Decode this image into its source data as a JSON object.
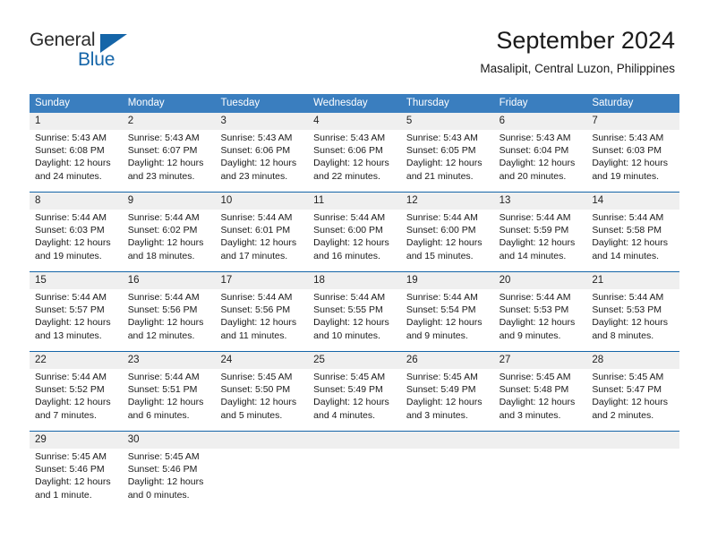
{
  "logo": {
    "word_one": "General",
    "word_two": "Blue",
    "triangle_icon": "triangle-icon"
  },
  "header": {
    "title": "September 2024",
    "subtitle": "Masalipit, Central Luzon, Philippines"
  },
  "colors": {
    "header_blue": "#3a7ebf",
    "separator_blue": "#1565a8",
    "number_band_gray": "#efefef",
    "logo_blue": "#1565a8"
  },
  "calendar": {
    "day_headers": [
      "Sunday",
      "Monday",
      "Tuesday",
      "Wednesday",
      "Thursday",
      "Friday",
      "Saturday"
    ],
    "weeks": [
      {
        "numbers": [
          "1",
          "2",
          "3",
          "4",
          "5",
          "6",
          "7"
        ],
        "cells": [
          {
            "sunrise": "Sunrise: 5:43 AM",
            "sunset": "Sunset: 6:08 PM",
            "daylight1": "Daylight: 12 hours",
            "daylight2": "and 24 minutes."
          },
          {
            "sunrise": "Sunrise: 5:43 AM",
            "sunset": "Sunset: 6:07 PM",
            "daylight1": "Daylight: 12 hours",
            "daylight2": "and 23 minutes."
          },
          {
            "sunrise": "Sunrise: 5:43 AM",
            "sunset": "Sunset: 6:06 PM",
            "daylight1": "Daylight: 12 hours",
            "daylight2": "and 23 minutes."
          },
          {
            "sunrise": "Sunrise: 5:43 AM",
            "sunset": "Sunset: 6:06 PM",
            "daylight1": "Daylight: 12 hours",
            "daylight2": "and 22 minutes."
          },
          {
            "sunrise": "Sunrise: 5:43 AM",
            "sunset": "Sunset: 6:05 PM",
            "daylight1": "Daylight: 12 hours",
            "daylight2": "and 21 minutes."
          },
          {
            "sunrise": "Sunrise: 5:43 AM",
            "sunset": "Sunset: 6:04 PM",
            "daylight1": "Daylight: 12 hours",
            "daylight2": "and 20 minutes."
          },
          {
            "sunrise": "Sunrise: 5:43 AM",
            "sunset": "Sunset: 6:03 PM",
            "daylight1": "Daylight: 12 hours",
            "daylight2": "and 19 minutes."
          }
        ]
      },
      {
        "numbers": [
          "8",
          "9",
          "10",
          "11",
          "12",
          "13",
          "14"
        ],
        "cells": [
          {
            "sunrise": "Sunrise: 5:44 AM",
            "sunset": "Sunset: 6:03 PM",
            "daylight1": "Daylight: 12 hours",
            "daylight2": "and 19 minutes."
          },
          {
            "sunrise": "Sunrise: 5:44 AM",
            "sunset": "Sunset: 6:02 PM",
            "daylight1": "Daylight: 12 hours",
            "daylight2": "and 18 minutes."
          },
          {
            "sunrise": "Sunrise: 5:44 AM",
            "sunset": "Sunset: 6:01 PM",
            "daylight1": "Daylight: 12 hours",
            "daylight2": "and 17 minutes."
          },
          {
            "sunrise": "Sunrise: 5:44 AM",
            "sunset": "Sunset: 6:00 PM",
            "daylight1": "Daylight: 12 hours",
            "daylight2": "and 16 minutes."
          },
          {
            "sunrise": "Sunrise: 5:44 AM",
            "sunset": "Sunset: 6:00 PM",
            "daylight1": "Daylight: 12 hours",
            "daylight2": "and 15 minutes."
          },
          {
            "sunrise": "Sunrise: 5:44 AM",
            "sunset": "Sunset: 5:59 PM",
            "daylight1": "Daylight: 12 hours",
            "daylight2": "and 14 minutes."
          },
          {
            "sunrise": "Sunrise: 5:44 AM",
            "sunset": "Sunset: 5:58 PM",
            "daylight1": "Daylight: 12 hours",
            "daylight2": "and 14 minutes."
          }
        ]
      },
      {
        "numbers": [
          "15",
          "16",
          "17",
          "18",
          "19",
          "20",
          "21"
        ],
        "cells": [
          {
            "sunrise": "Sunrise: 5:44 AM",
            "sunset": "Sunset: 5:57 PM",
            "daylight1": "Daylight: 12 hours",
            "daylight2": "and 13 minutes."
          },
          {
            "sunrise": "Sunrise: 5:44 AM",
            "sunset": "Sunset: 5:56 PM",
            "daylight1": "Daylight: 12 hours",
            "daylight2": "and 12 minutes."
          },
          {
            "sunrise": "Sunrise: 5:44 AM",
            "sunset": "Sunset: 5:56 PM",
            "daylight1": "Daylight: 12 hours",
            "daylight2": "and 11 minutes."
          },
          {
            "sunrise": "Sunrise: 5:44 AM",
            "sunset": "Sunset: 5:55 PM",
            "daylight1": "Daylight: 12 hours",
            "daylight2": "and 10 minutes."
          },
          {
            "sunrise": "Sunrise: 5:44 AM",
            "sunset": "Sunset: 5:54 PM",
            "daylight1": "Daylight: 12 hours",
            "daylight2": "and 9 minutes."
          },
          {
            "sunrise": "Sunrise: 5:44 AM",
            "sunset": "Sunset: 5:53 PM",
            "daylight1": "Daylight: 12 hours",
            "daylight2": "and 9 minutes."
          },
          {
            "sunrise": "Sunrise: 5:44 AM",
            "sunset": "Sunset: 5:53 PM",
            "daylight1": "Daylight: 12 hours",
            "daylight2": "and 8 minutes."
          }
        ]
      },
      {
        "numbers": [
          "22",
          "23",
          "24",
          "25",
          "26",
          "27",
          "28"
        ],
        "cells": [
          {
            "sunrise": "Sunrise: 5:44 AM",
            "sunset": "Sunset: 5:52 PM",
            "daylight1": "Daylight: 12 hours",
            "daylight2": "and 7 minutes."
          },
          {
            "sunrise": "Sunrise: 5:44 AM",
            "sunset": "Sunset: 5:51 PM",
            "daylight1": "Daylight: 12 hours",
            "daylight2": "and 6 minutes."
          },
          {
            "sunrise": "Sunrise: 5:45 AM",
            "sunset": "Sunset: 5:50 PM",
            "daylight1": "Daylight: 12 hours",
            "daylight2": "and 5 minutes."
          },
          {
            "sunrise": "Sunrise: 5:45 AM",
            "sunset": "Sunset: 5:49 PM",
            "daylight1": "Daylight: 12 hours",
            "daylight2": "and 4 minutes."
          },
          {
            "sunrise": "Sunrise: 5:45 AM",
            "sunset": "Sunset: 5:49 PM",
            "daylight1": "Daylight: 12 hours",
            "daylight2": "and 3 minutes."
          },
          {
            "sunrise": "Sunrise: 5:45 AM",
            "sunset": "Sunset: 5:48 PM",
            "daylight1": "Daylight: 12 hours",
            "daylight2": "and 3 minutes."
          },
          {
            "sunrise": "Sunrise: 5:45 AM",
            "sunset": "Sunset: 5:47 PM",
            "daylight1": "Daylight: 12 hours",
            "daylight2": "and 2 minutes."
          }
        ]
      },
      {
        "numbers": [
          "29",
          "30",
          "",
          "",
          "",
          "",
          ""
        ],
        "cells": [
          {
            "sunrise": "Sunrise: 5:45 AM",
            "sunset": "Sunset: 5:46 PM",
            "daylight1": "Daylight: 12 hours",
            "daylight2": "and 1 minute."
          },
          {
            "sunrise": "Sunrise: 5:45 AM",
            "sunset": "Sunset: 5:46 PM",
            "daylight1": "Daylight: 12 hours",
            "daylight2": "and 0 minutes."
          },
          {
            "sunrise": "",
            "sunset": "",
            "daylight1": "",
            "daylight2": ""
          },
          {
            "sunrise": "",
            "sunset": "",
            "daylight1": "",
            "daylight2": ""
          },
          {
            "sunrise": "",
            "sunset": "",
            "daylight1": "",
            "daylight2": ""
          },
          {
            "sunrise": "",
            "sunset": "",
            "daylight1": "",
            "daylight2": ""
          },
          {
            "sunrise": "",
            "sunset": "",
            "daylight1": "",
            "daylight2": ""
          }
        ]
      }
    ]
  }
}
